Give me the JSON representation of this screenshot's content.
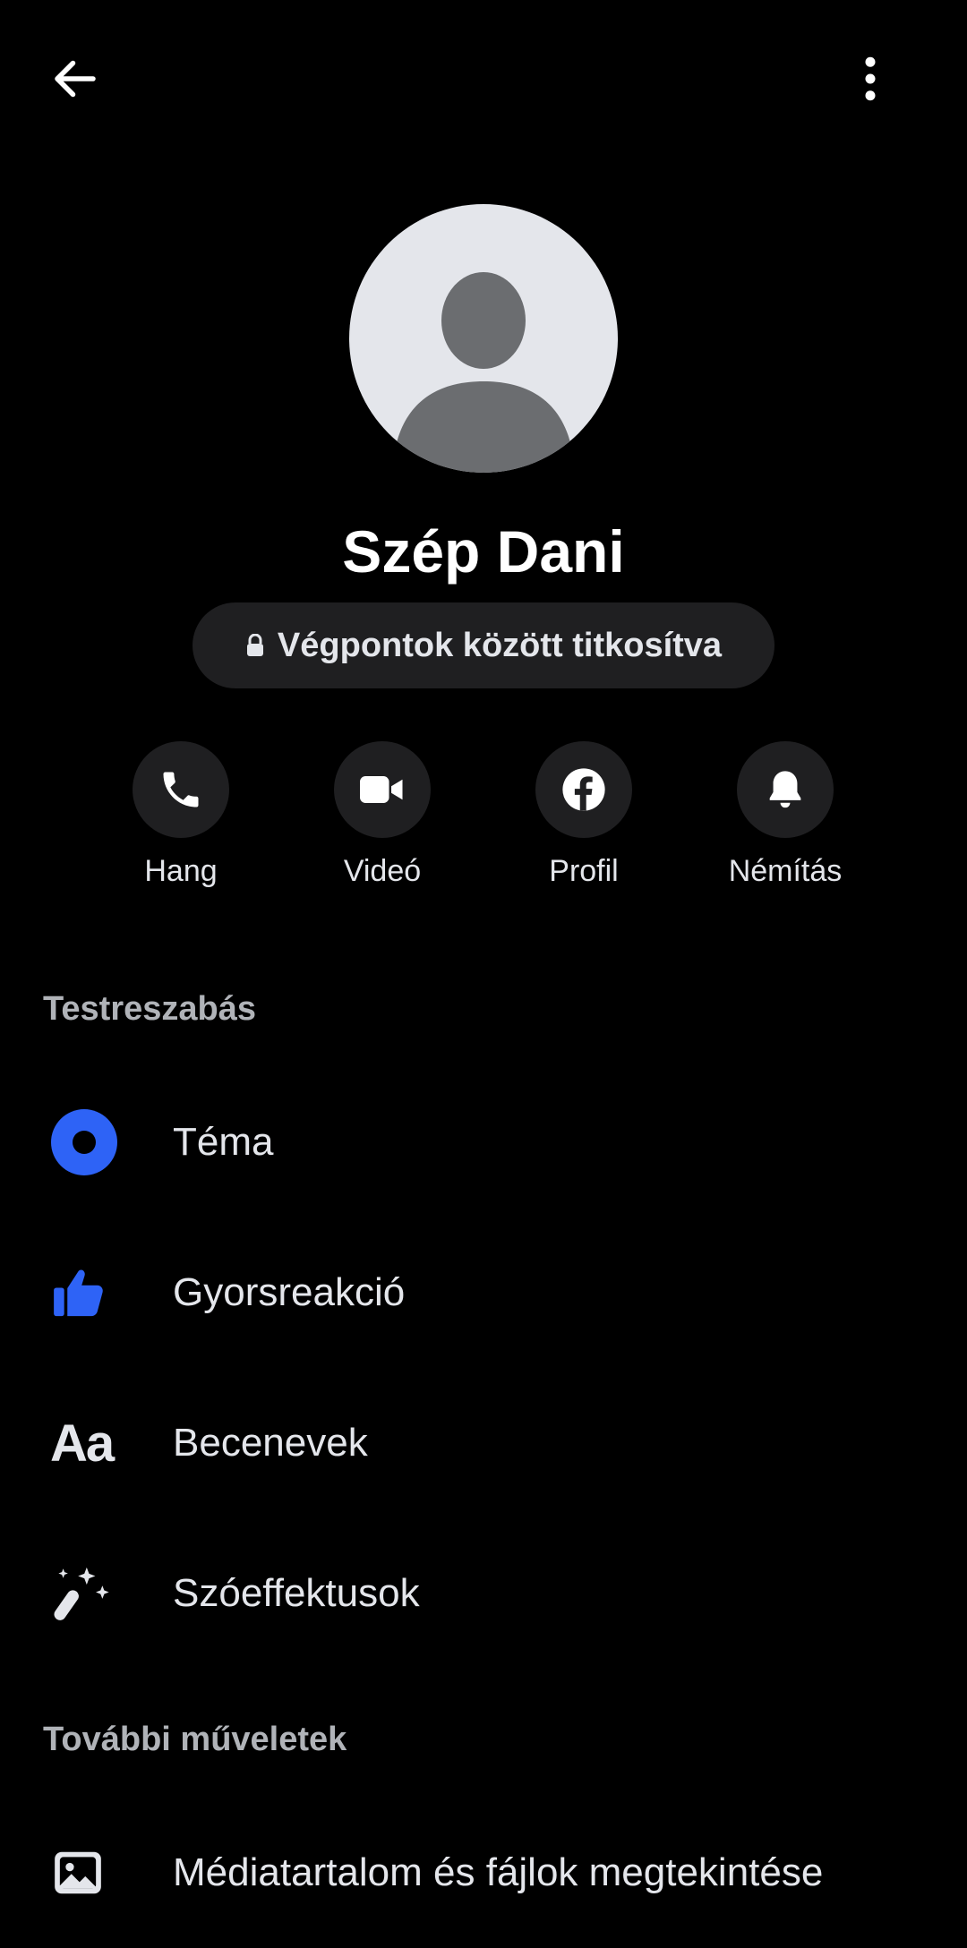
{
  "header": {
    "back_icon": "arrow-left-icon",
    "menu_icon": "more-vertical-icon"
  },
  "contact": {
    "name": "Szép Dani",
    "encryption_label": "Végpontok között titkosítva",
    "avatar_icon": "default-avatar-icon"
  },
  "actions": [
    {
      "label": "Hang",
      "icon": "phone-icon"
    },
    {
      "label": "Videó",
      "icon": "video-camera-icon"
    },
    {
      "label": "Profil",
      "icon": "facebook-icon"
    },
    {
      "label": "Némítás",
      "icon": "bell-icon"
    }
  ],
  "sections": {
    "customization": {
      "title": "Testreszabás",
      "items": [
        {
          "label": "Téma",
          "icon": "theme-icon"
        },
        {
          "label": "Gyorsreakció",
          "icon": "thumbs-up-icon"
        },
        {
          "label": "Becenevek",
          "icon": "aa-text-icon",
          "glyph": "Aa"
        },
        {
          "label": "Szóeffektusok",
          "icon": "magic-wand-icon"
        }
      ]
    },
    "more_actions": {
      "title": "További műveletek",
      "items": [
        {
          "label": "Médiatartalom és fájlok megtekintése",
          "icon": "image-icon"
        }
      ]
    }
  },
  "colors": {
    "background": "#000000",
    "accent": "#2e63f6",
    "chip_background": "#1f1f21",
    "text_primary": "#e4e6eb",
    "text_secondary": "#b0b3b8"
  }
}
